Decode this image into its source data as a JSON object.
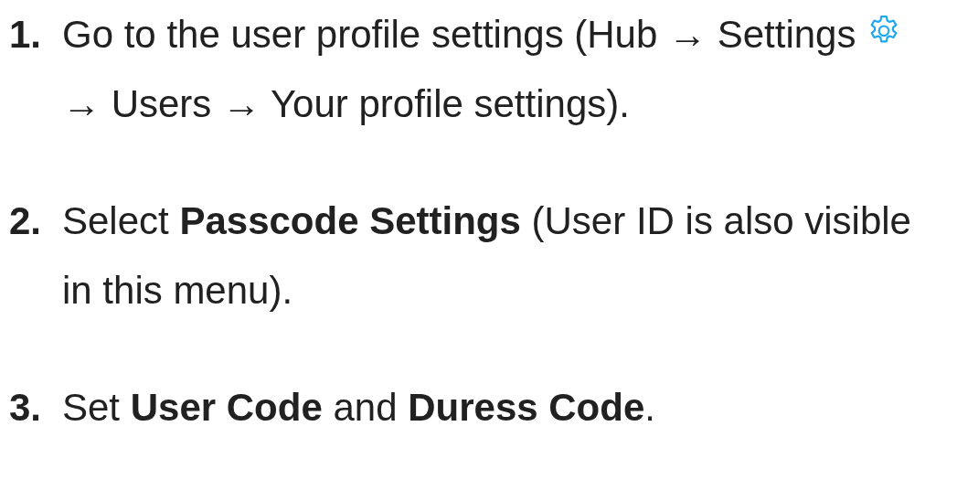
{
  "steps": [
    {
      "number": "1.",
      "parts": [
        {
          "kind": "text",
          "text": "Go to the user profile settings (Hub → Settings"
        },
        {
          "kind": "icon"
        },
        {
          "kind": "text",
          "text": "→ Users → Your profile settings)."
        }
      ]
    },
    {
      "number": "2.",
      "parts": [
        {
          "kind": "text",
          "text": "Select **Passcode Settings** (User ID is also visible in this menu)."
        }
      ]
    },
    {
      "number": "3.",
      "parts": [
        {
          "kind": "text",
          "text": "Set **User Code** and **Duress Code**."
        }
      ]
    }
  ]
}
